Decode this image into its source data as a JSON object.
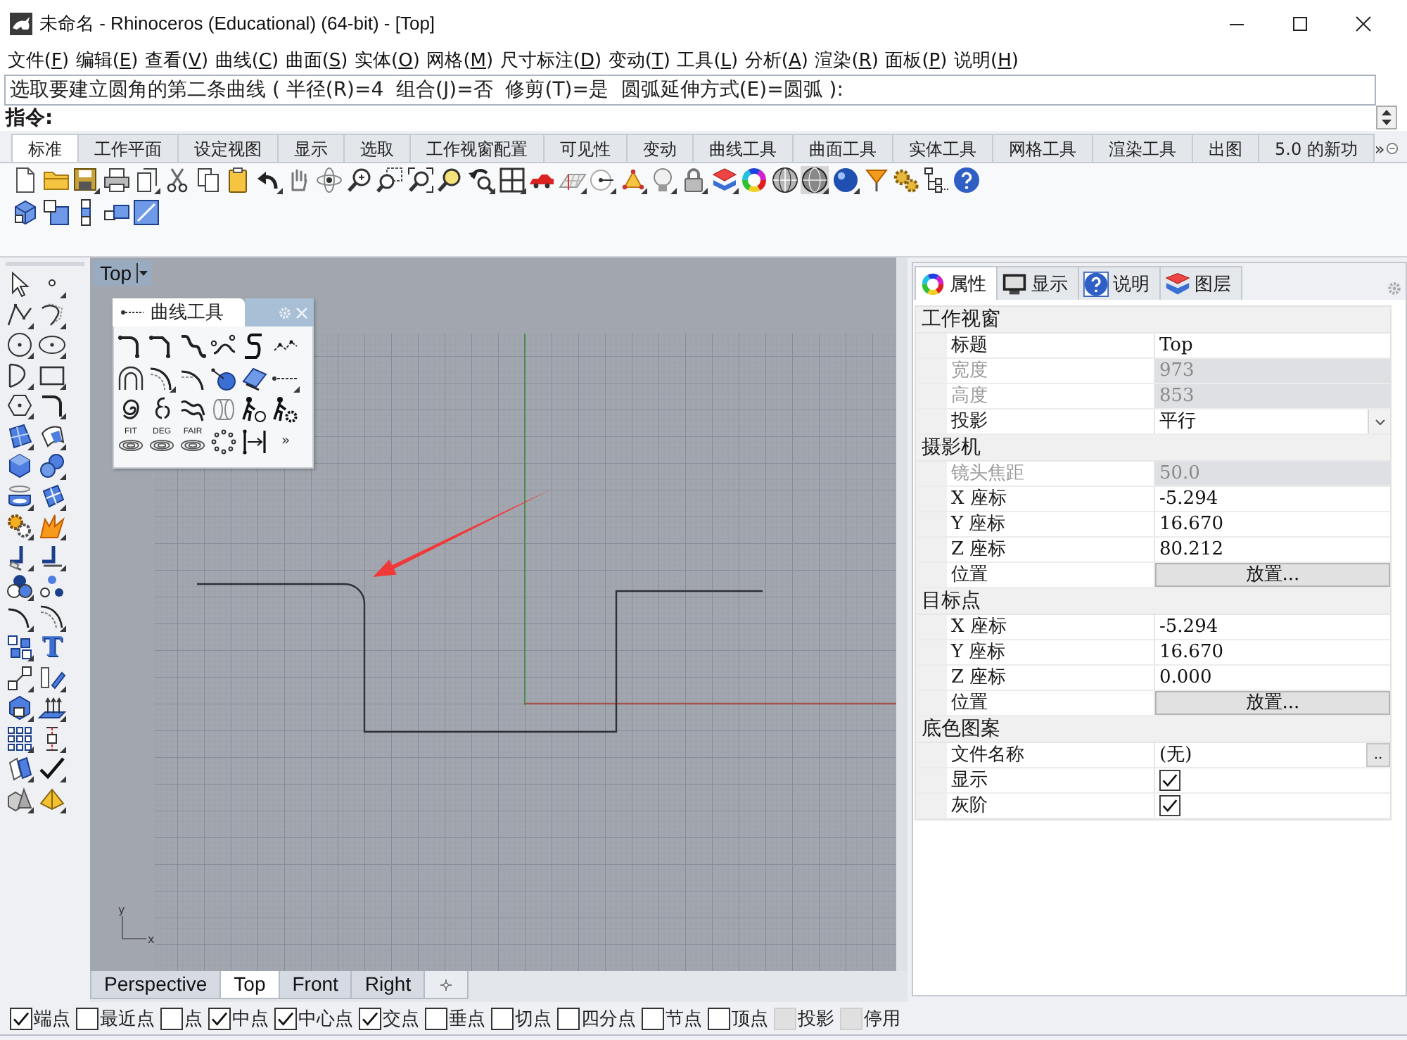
{
  "window": {
    "title": "未命名 - Rhinoceros (Educational) (64-bit) - [Top]"
  },
  "menu": [
    {
      "before": "文件(",
      "key": "F",
      "after": ")"
    },
    {
      "before": "编辑(",
      "key": "E",
      "after": ")"
    },
    {
      "before": "查看(",
      "key": "V",
      "after": ")"
    },
    {
      "before": "曲线(",
      "key": "C",
      "after": ")"
    },
    {
      "before": "曲面(",
      "key": "S",
      "after": ")"
    },
    {
      "before": "实体(",
      "key": "O",
      "after": ")"
    },
    {
      "before": "网格(",
      "key": "M",
      "after": ")"
    },
    {
      "before": "尺寸标注(",
      "key": "D",
      "after": ")"
    },
    {
      "before": "变动(",
      "key": "T",
      "after": ")"
    },
    {
      "before": "工具(",
      "key": "L",
      "after": ")"
    },
    {
      "before": "分析(",
      "key": "A",
      "after": ")"
    },
    {
      "before": "渲染(",
      "key": "R",
      "after": ")"
    },
    {
      "before": "面板(",
      "key": "P",
      "after": ")"
    },
    {
      "before": "说明(",
      "key": "H",
      "after": ")"
    }
  ],
  "command": {
    "history": "选取要建立圆角的第二条曲线 ( 半径(R)=4  组合(J)=否  修剪(T)=是  圆弧延伸方式(E)=圆弧 ):",
    "prompt": "指令:"
  },
  "toolbar_tabs": [
    {
      "label": "标准",
      "selected": true
    },
    {
      "label": "工作平面",
      "selected": false
    },
    {
      "label": "设定视图",
      "selected": false
    },
    {
      "label": "显示",
      "selected": false
    },
    {
      "label": "选取",
      "selected": false
    },
    {
      "label": "工作视窗配置",
      "selected": false
    },
    {
      "label": "可见性",
      "selected": false
    },
    {
      "label": "变动",
      "selected": false
    },
    {
      "label": "曲线工具",
      "selected": false
    },
    {
      "label": "曲面工具",
      "selected": false
    },
    {
      "label": "实体工具",
      "selected": false
    },
    {
      "label": "网格工具",
      "selected": false
    },
    {
      "label": "渲染工具",
      "selected": false
    },
    {
      "label": "出图",
      "selected": false
    },
    {
      "label": "5.0 的新功",
      "selected": false
    }
  ],
  "toolbar_tabs_overflow": "»",
  "left_toolbar": {
    "text_tool": "T"
  },
  "viewport": {
    "title": "Top",
    "axis_x": "x",
    "axis_y": "y"
  },
  "curve_palette": {
    "title": "曲线工具",
    "labeled_tools": [
      "FIT",
      "DEG",
      "FAIR"
    ],
    "more": "»"
  },
  "properties_panel": {
    "tabs": [
      {
        "label": "属性",
        "selected": true
      },
      {
        "label": "显示",
        "selected": false
      },
      {
        "label": "说明",
        "selected": false
      },
      {
        "label": "图层",
        "selected": false
      }
    ],
    "sections": [
      {
        "title": "工作视窗",
        "rows": [
          {
            "kind": "text",
            "label": "标题",
            "value": "Top",
            "disabled": false
          },
          {
            "kind": "text",
            "label": "宽度",
            "value": "973",
            "disabled": true
          },
          {
            "kind": "text",
            "label": "高度",
            "value": "853",
            "disabled": true
          },
          {
            "kind": "dropdown",
            "label": "投影",
            "value": "平行",
            "disabled": false
          }
        ]
      },
      {
        "title": "摄影机",
        "rows": [
          {
            "kind": "text",
            "label": "镜头焦距",
            "value": "50.0",
            "disabled": true
          },
          {
            "kind": "text",
            "label": "X 座标",
            "value": "-5.294",
            "disabled": false
          },
          {
            "kind": "text",
            "label": "Y 座标",
            "value": "16.670",
            "disabled": false
          },
          {
            "kind": "text",
            "label": "Z 座标",
            "value": "80.212",
            "disabled": false
          },
          {
            "kind": "button",
            "label": "位置",
            "button_label": "放置...",
            "disabled": false
          }
        ]
      },
      {
        "title": "目标点",
        "rows": [
          {
            "kind": "text",
            "label": "X 座标",
            "value": "-5.294",
            "disabled": false
          },
          {
            "kind": "text",
            "label": "Y 座标",
            "value": "16.670",
            "disabled": false
          },
          {
            "kind": "text",
            "label": "Z 座标",
            "value": "0.000",
            "disabled": false
          },
          {
            "kind": "button",
            "label": "位置",
            "button_label": "放置...",
            "disabled": false
          }
        ]
      },
      {
        "title": "底色图案",
        "rows": [
          {
            "kind": "file",
            "label": "文件名称",
            "value": "(无)",
            "button_label": "..",
            "disabled": false
          },
          {
            "kind": "checkbox",
            "label": "显示",
            "checked": true,
            "disabled": false
          },
          {
            "kind": "checkbox",
            "label": "灰阶",
            "checked": true,
            "disabled": false
          }
        ]
      }
    ]
  },
  "viewport_tabs": [
    {
      "label": "Perspective",
      "selected": false
    },
    {
      "label": "Top",
      "selected": true
    },
    {
      "label": "Front",
      "selected": false
    },
    {
      "label": "Right",
      "selected": false
    }
  ],
  "osnaps": [
    {
      "label": "端点",
      "checked": true,
      "disabled": false
    },
    {
      "label": "最近点",
      "checked": false,
      "disabled": false
    },
    {
      "label": "点",
      "checked": false,
      "disabled": false
    },
    {
      "label": "中点",
      "checked": true,
      "disabled": false
    },
    {
      "label": "中心点",
      "checked": true,
      "disabled": false
    },
    {
      "label": "交点",
      "checked": true,
      "disabled": false
    },
    {
      "label": "垂点",
      "checked": false,
      "disabled": false
    },
    {
      "label": "切点",
      "checked": false,
      "disabled": false
    },
    {
      "label": "四分点",
      "checked": false,
      "disabled": false
    },
    {
      "label": "节点",
      "checked": false,
      "disabled": false
    },
    {
      "label": "顶点",
      "checked": false,
      "disabled": false
    },
    {
      "label": "投影",
      "checked": false,
      "disabled": true
    },
    {
      "label": "停用",
      "checked": false,
      "disabled": true
    }
  ]
}
